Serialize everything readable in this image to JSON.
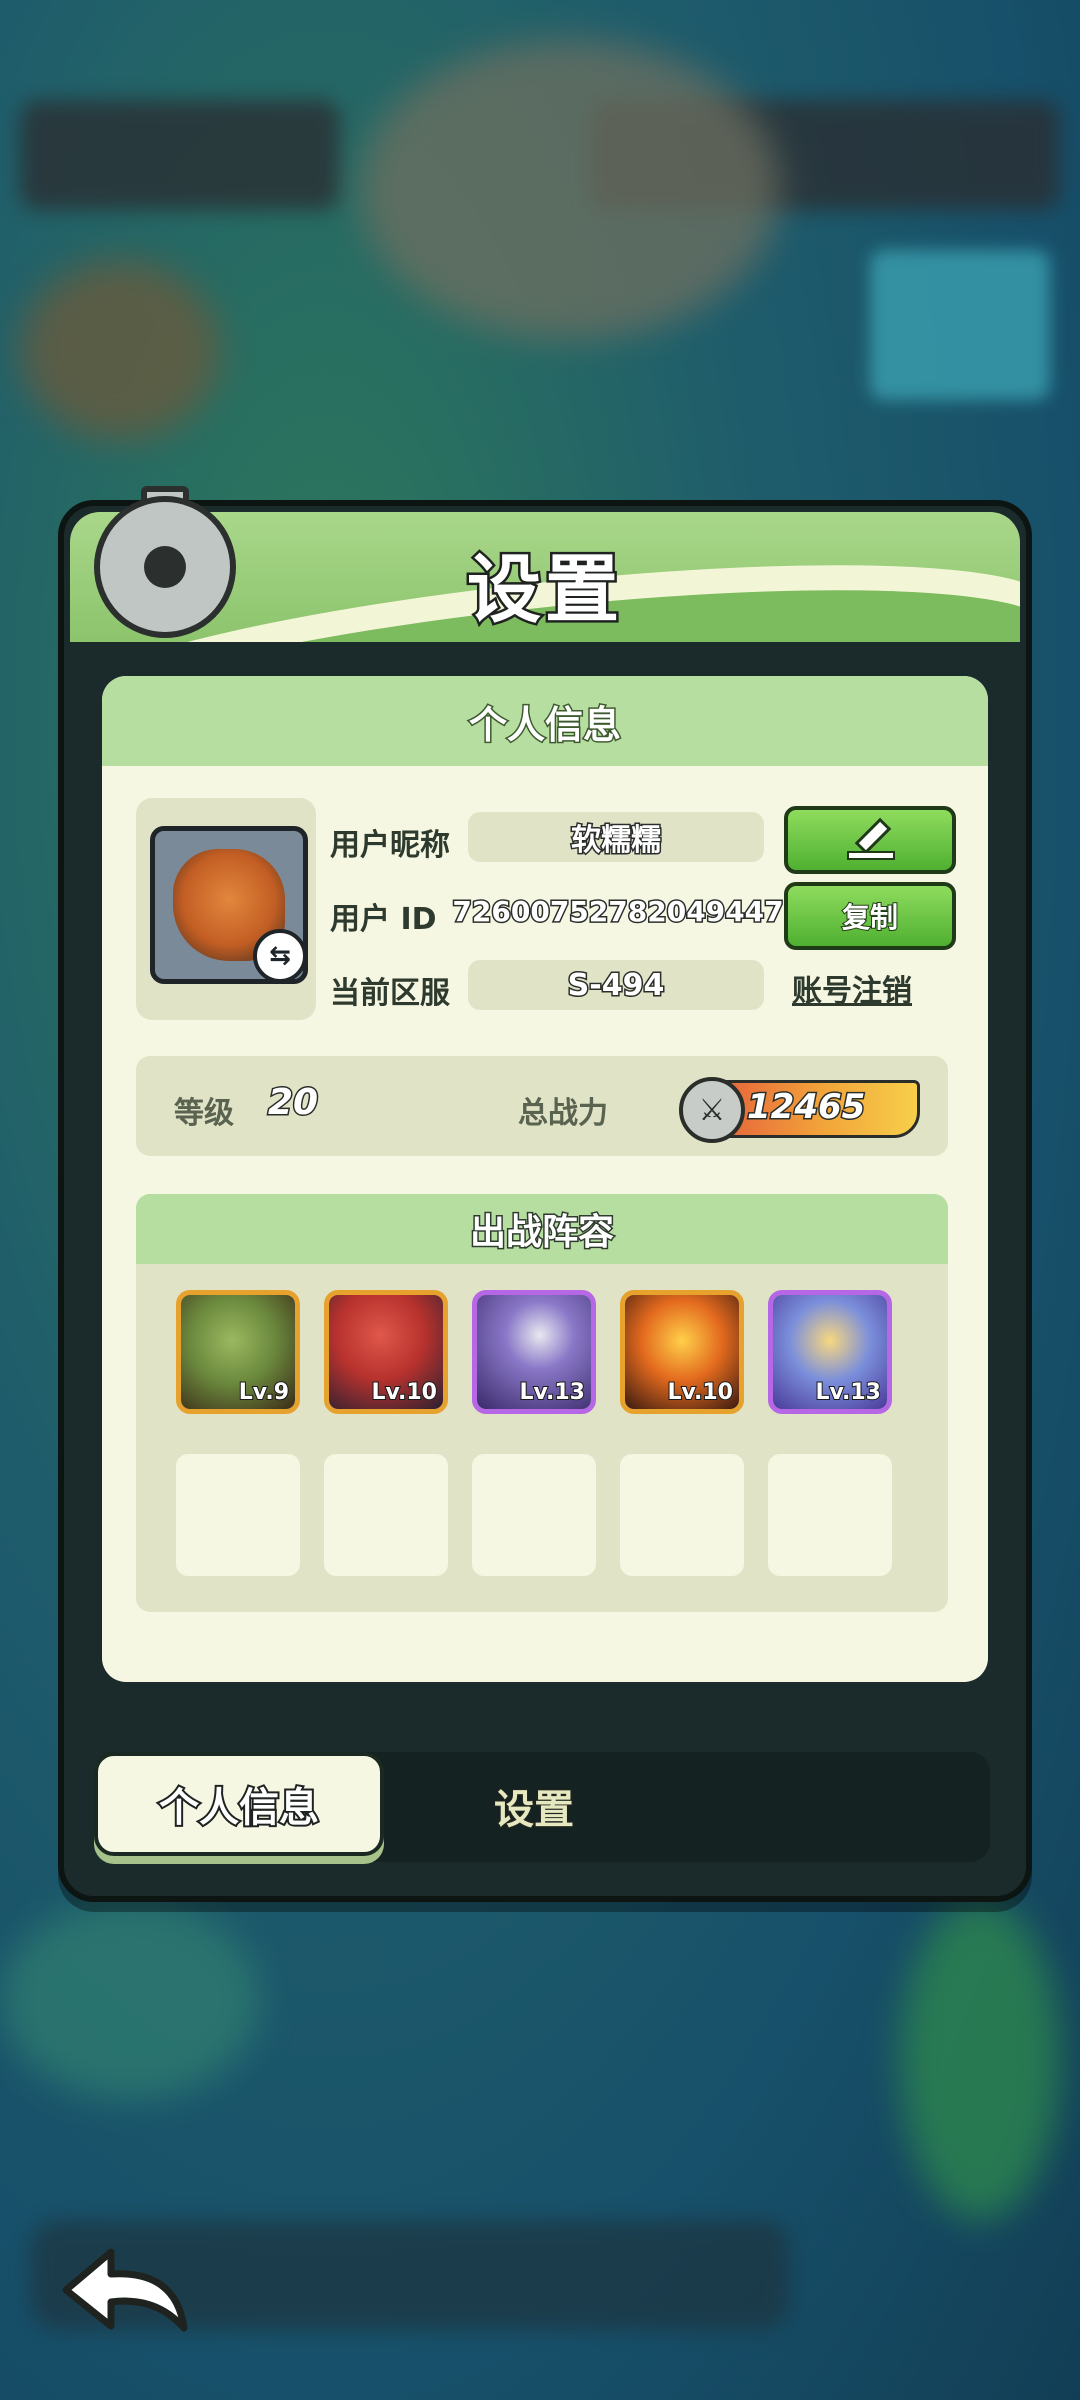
{
  "panel": {
    "title": "设置"
  },
  "profile": {
    "section_title": "个人信息",
    "nickname_label": "用户昵称",
    "nickname": "软糯糯",
    "id_label": "用户  ID",
    "id_value": "7260075278204944​7",
    "server_label": "当前区服",
    "server_value": "S-494",
    "copy_label": "复制",
    "deregister_label": "账号注销"
  },
  "stats": {
    "level_label": "等级",
    "level_value": "20",
    "power_label": "总战力",
    "power_value": "12465"
  },
  "lineup": {
    "title": "出战阵容",
    "heroes": [
      {
        "level": "Lv.9",
        "rarity": "legendary",
        "color": "#6c8a3e"
      },
      {
        "level": "Lv.10",
        "rarity": "legendary",
        "color": "#b8322e"
      },
      {
        "level": "Lv.13",
        "rarity": "epic",
        "color": "#5a3f99"
      },
      {
        "level": "Lv.10",
        "rarity": "legendary",
        "color": "#e36a1e"
      },
      {
        "level": "Lv.13",
        "rarity": "epic",
        "color": "#7b8fdb"
      }
    ],
    "empty_slots": 5
  },
  "tabs": {
    "active": "个人信息",
    "inactive": "设置"
  },
  "colors": {
    "accent_green": "#8cc46c",
    "panel_cream": "#f6f7e3",
    "legendary": "#e7a12d",
    "epic": "#b567e6"
  }
}
